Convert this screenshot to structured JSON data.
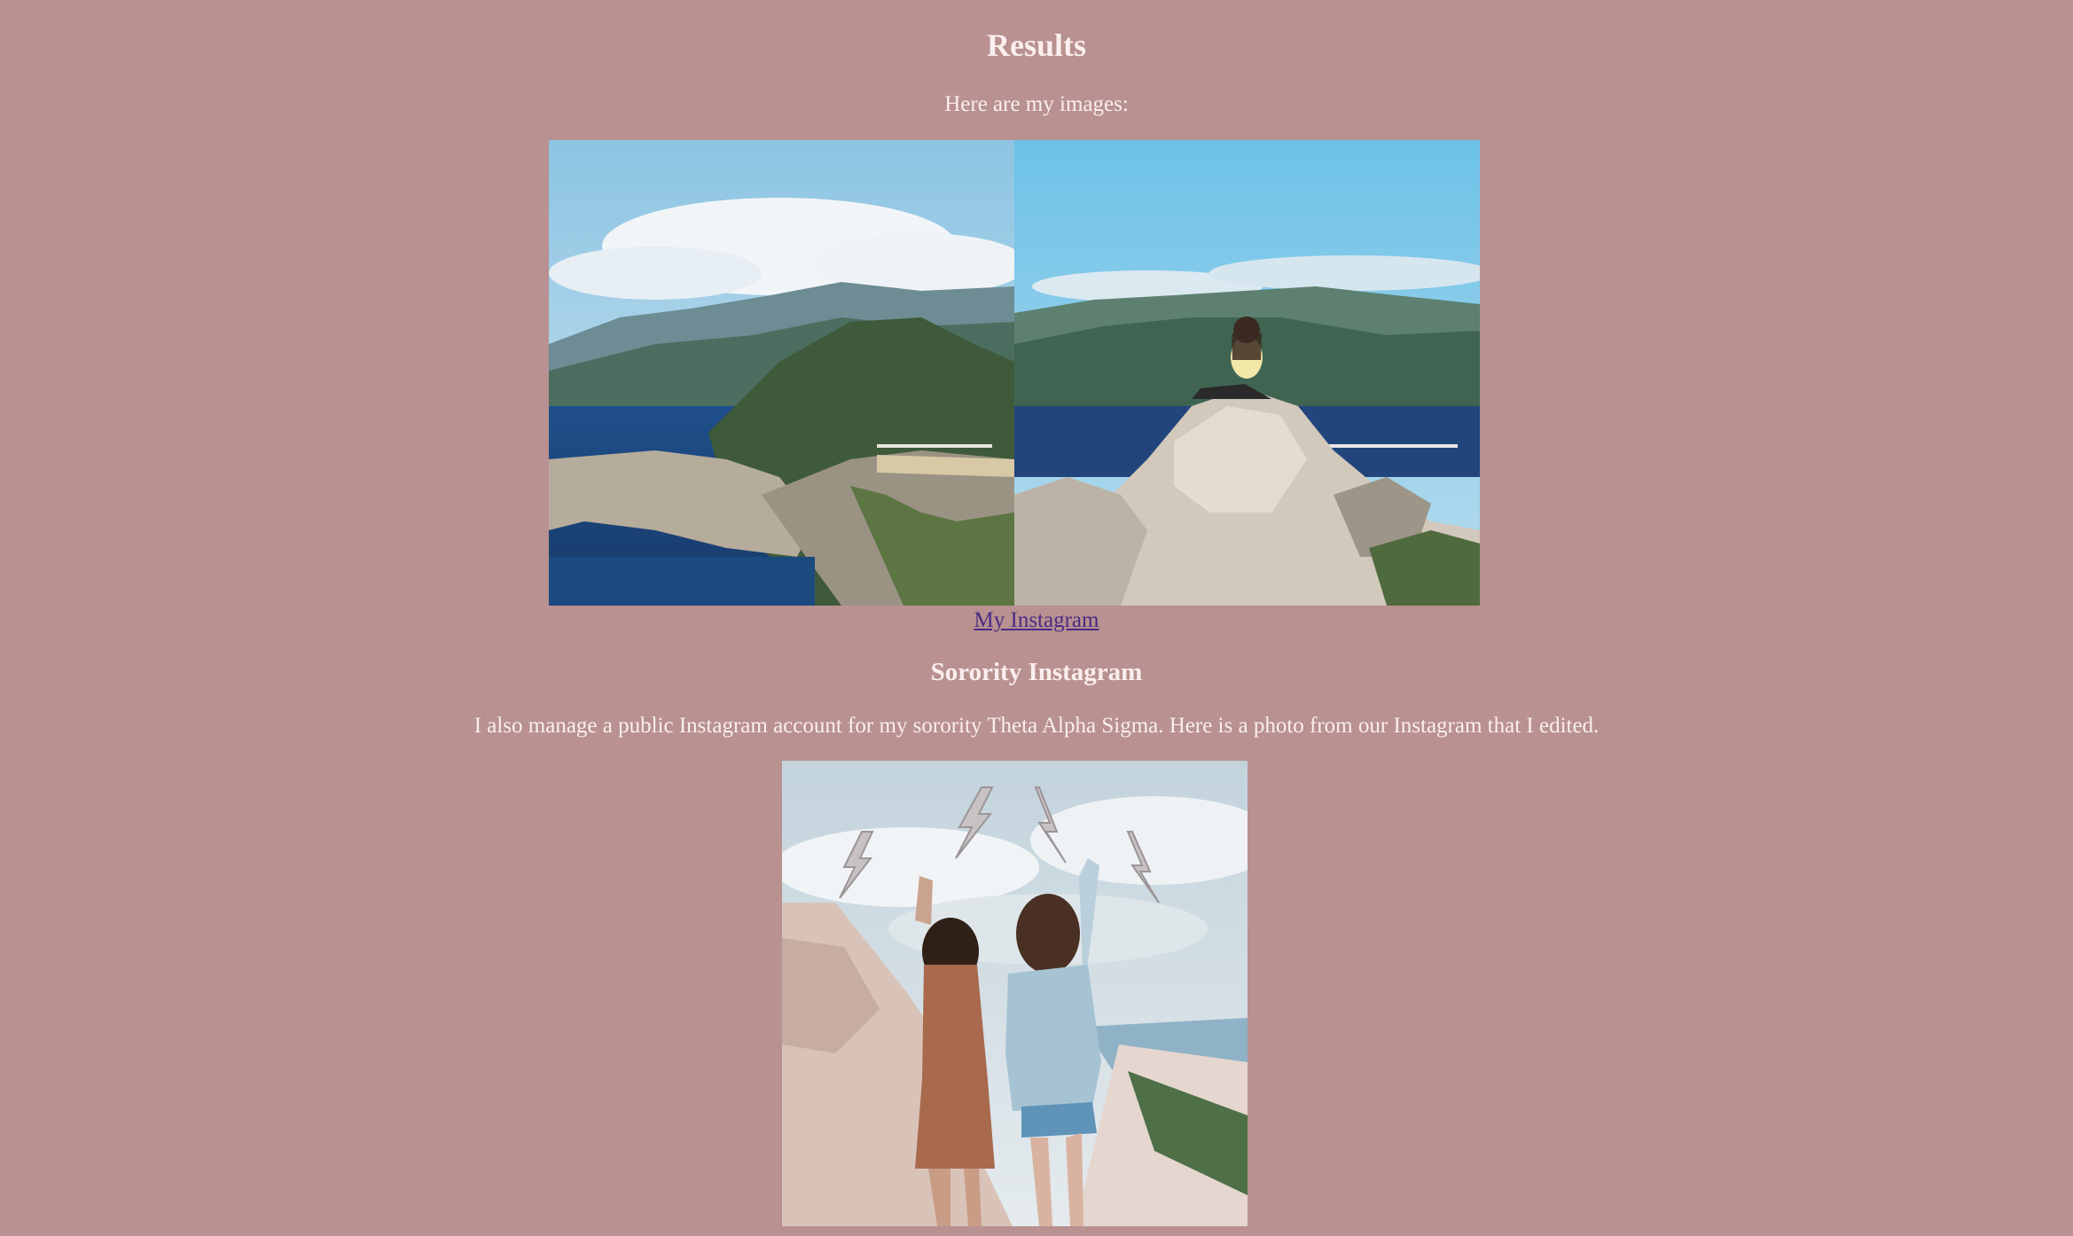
{
  "page": {
    "background": "#b89190",
    "text_color": "#fbeeee",
    "link_color": "#4b2a86"
  },
  "results": {
    "title": "Results",
    "intro": "Here are my images:",
    "images": [
      {
        "name": "big-sur-bridge-landscape-photo"
      },
      {
        "name": "woman-sitting-on-rock-photo"
      }
    ],
    "instagram_link": "My Instagram"
  },
  "sorority": {
    "title": "Sorority Instagram",
    "text": "I also manage a public Instagram account for my sorority Theta Alpha Sigma. Here is a photo from our Instagram that I edited.",
    "image": {
      "name": "sorority-friends-photo"
    }
  }
}
